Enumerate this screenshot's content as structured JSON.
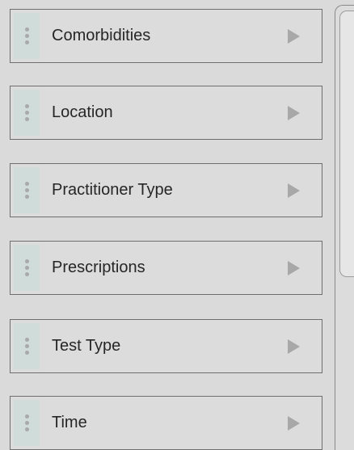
{
  "filter_list": {
    "items": [
      {
        "label": "Comorbidities"
      },
      {
        "label": "Location"
      },
      {
        "label": "Practitioner Type"
      },
      {
        "label": "Prescriptions"
      },
      {
        "label": "Test Type"
      },
      {
        "label": "Time"
      }
    ]
  },
  "icons": {
    "drag_handle": "drag-handle-icon",
    "expand": "chevron-right-icon"
  },
  "colors": {
    "background": "#dadada",
    "item_border": "#6f6f6f",
    "handle_background": "#cfdcd9",
    "arrow": "#a8a8a8",
    "text": "#262626"
  }
}
